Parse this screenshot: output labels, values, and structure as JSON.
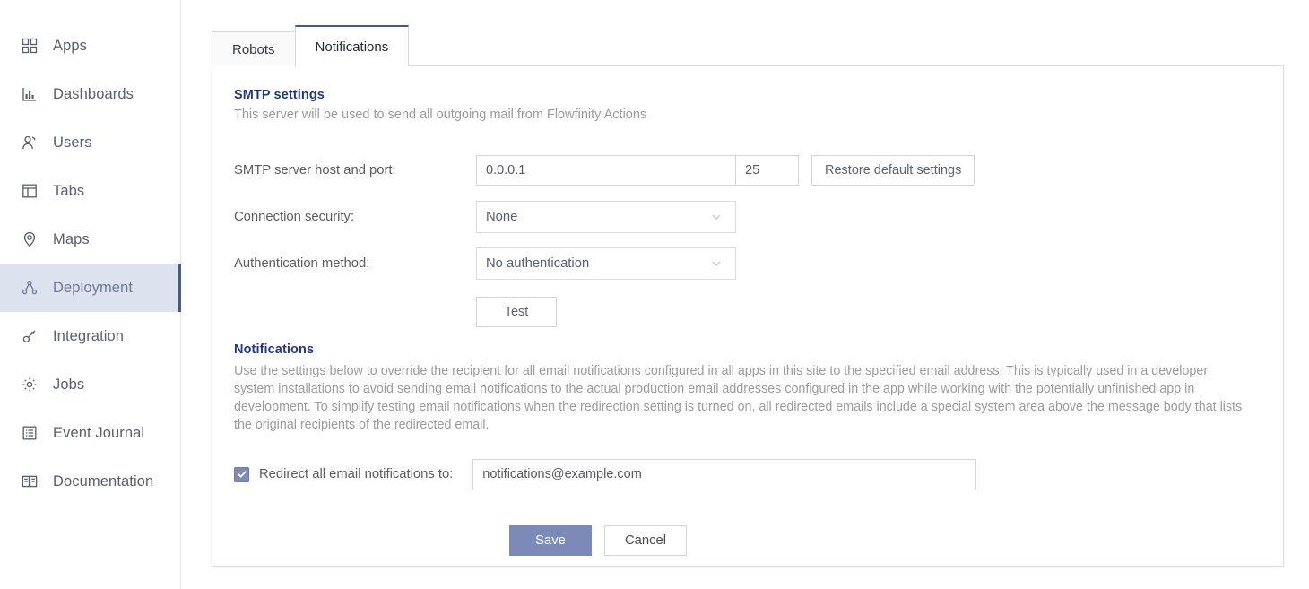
{
  "sidebar": {
    "items": [
      {
        "label": "Apps",
        "icon": "grid-icon",
        "active": false
      },
      {
        "label": "Dashboards",
        "icon": "bar-chart-icon",
        "active": false
      },
      {
        "label": "Users",
        "icon": "users-icon",
        "active": false
      },
      {
        "label": "Tabs",
        "icon": "layout-icon",
        "active": false
      },
      {
        "label": "Maps",
        "icon": "map-pin-icon",
        "active": false
      },
      {
        "label": "Deployment",
        "icon": "deployment-node-icon",
        "active": true
      },
      {
        "label": "Integration",
        "icon": "plug-icon",
        "active": false
      },
      {
        "label": "Jobs",
        "icon": "gear-icon",
        "active": false
      },
      {
        "label": "Event Journal",
        "icon": "journal-icon",
        "active": false
      },
      {
        "label": "Documentation",
        "icon": "book-icon",
        "active": false
      }
    ]
  },
  "tabs": [
    {
      "label": "Robots",
      "active": false
    },
    {
      "label": "Notifications",
      "active": true
    }
  ],
  "smtp": {
    "section_title": "SMTP settings",
    "section_subtitle": "This server will be used to send all outgoing mail from Flowfinity Actions",
    "host_label": "SMTP server host and port:",
    "host_value": "0.0.0.1",
    "port_value": "25",
    "restore_button": "Restore default settings",
    "security_label": "Connection security:",
    "security_value": "None",
    "auth_label": "Authentication method:",
    "auth_value": "No authentication",
    "test_button": "Test"
  },
  "notifications": {
    "section_title": "Notifications",
    "description": "Use the settings below to override the recipient for all email notifications configured in all apps in this site to the specified email address. This is typically used in a developer system installations to avoid sending email notifications to the actual production email addresses configured in the app while working with the potentially unfinished app in development. To simplify testing email notifications when the redirection setting is turned on, all redirected emails include a special system area above the message body that lists the original recipients of the redirected email.",
    "redirect_label": "Redirect all email notifications to:",
    "redirect_checked": true,
    "redirect_email": "notifications@example.com"
  },
  "footer": {
    "save_label": "Save",
    "cancel_label": "Cancel"
  },
  "colors": {
    "accent_blue": "#213a7a",
    "save_button": "#7b8ab8",
    "active_nav_bg": "#dce3ef",
    "active_nav_bar": "#4a5a7a",
    "active_tab_border": "#4a5a7a"
  }
}
